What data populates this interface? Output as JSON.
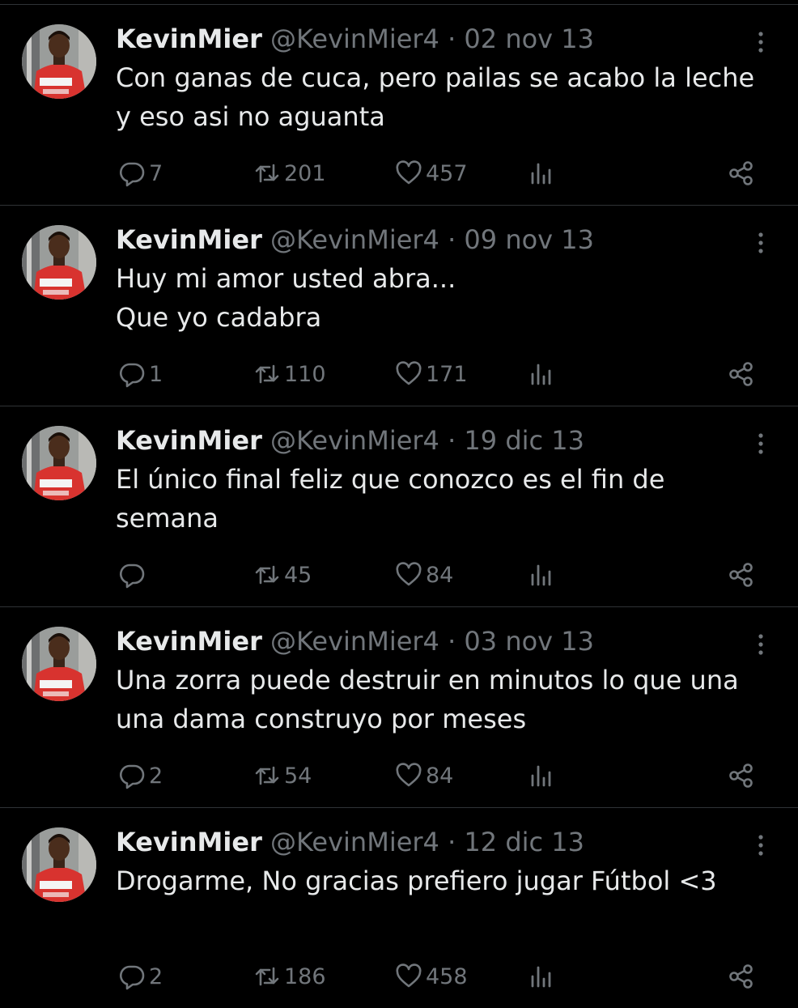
{
  "icons": {
    "reply": "reply-icon",
    "retweet": "retweet-icon",
    "like": "heart-icon",
    "views": "views-icon",
    "share": "share-icon",
    "more": "more-icon"
  },
  "colors": {
    "background": "#000000",
    "text": "#e7e9ea",
    "muted": "#71767b",
    "divider": "#2f3336"
  },
  "tweets": [
    {
      "name": "KevinMier",
      "handle": "@KevinMier4",
      "separator": "·",
      "date": "02 nov 13",
      "text": "Con ganas de cuca, pero pailas se acabo la leche\ny eso asi no aguanta",
      "replies": "7",
      "retweets": "201",
      "likes": "457"
    },
    {
      "name": "KevinMier",
      "handle": "@KevinMier4",
      "separator": "·",
      "date": "09 nov 13",
      "text": "Huy mi amor usted abra...\nQue yo cadabra",
      "replies": "1",
      "retweets": "110",
      "likes": "171"
    },
    {
      "name": "KevinMier",
      "handle": "@KevinMier4",
      "separator": "·",
      "date": "19 dic 13",
      "text": "El único final feliz que conozco es el fin de\nsemana",
      "replies": "",
      "retweets": "45",
      "likes": "84"
    },
    {
      "name": "KevinMier",
      "handle": "@KevinMier4",
      "separator": "·",
      "date": "03 nov 13",
      "text": "Una zorra puede destruir en minutos lo que una\nuna dama construyo por meses",
      "replies": "2",
      "retweets": "54",
      "likes": "84"
    },
    {
      "name": "KevinMier",
      "handle": "@KevinMier4",
      "separator": "·",
      "date": "12 dic 13",
      "text": "Drogarme, No gracias prefiero jugar Fútbol <3",
      "replies": "2",
      "retweets": "186",
      "likes": "458"
    }
  ]
}
